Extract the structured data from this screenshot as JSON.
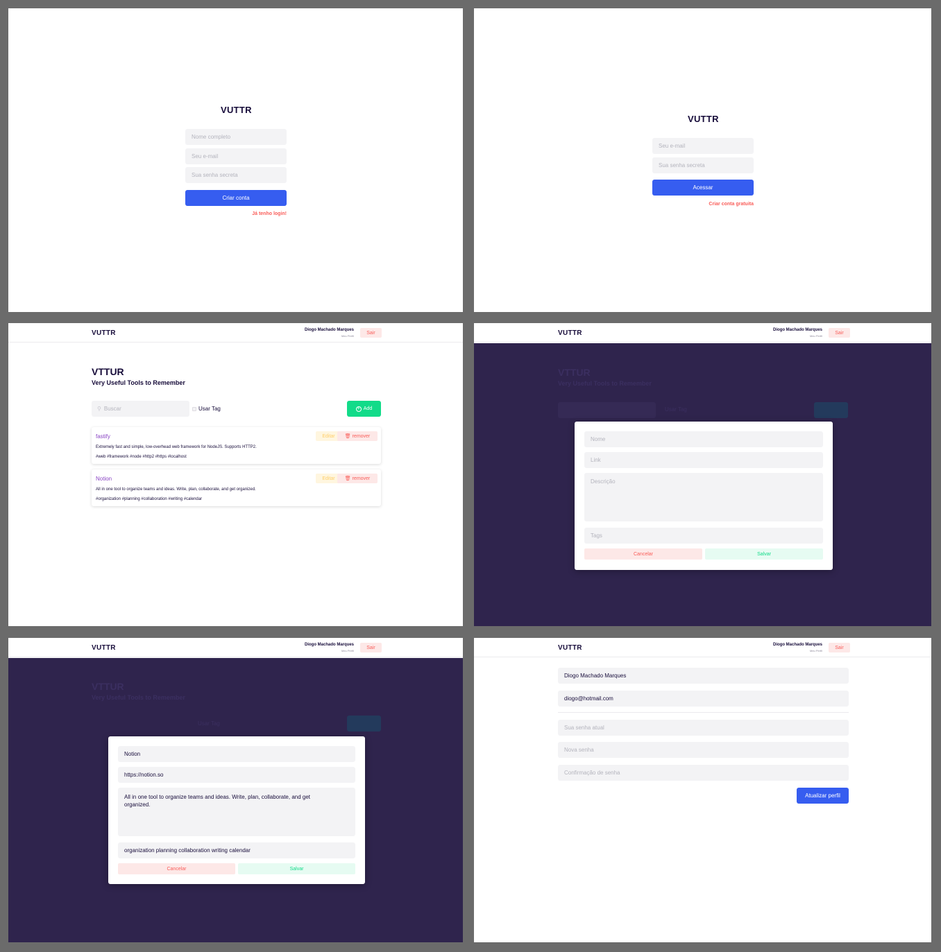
{
  "brand": "VUTTR",
  "signup": {
    "title": "VUTTR",
    "name_placeholder": "Nome completo",
    "email_placeholder": "Seu e-mail",
    "password_placeholder": "Sua senha secreta",
    "submit_label": "Criar conta",
    "login_link": "Já tenho login!"
  },
  "login": {
    "title": "VUTTR",
    "email_placeholder": "Seu e-mail",
    "password_placeholder": "Sua senha secreta",
    "submit_label": "Acessar",
    "signup_link": "Criar conta gratuita"
  },
  "header": {
    "brand": "VUTTR",
    "user_name": "Diogo Machado Marques",
    "profile_link": "Meu Perfil",
    "logout_label": "Sair"
  },
  "dashboard": {
    "title": "VTTUR",
    "subtitle": "Very Useful Tools to Remember",
    "search_placeholder": "Buscar",
    "tag_checkbox_label": "Usar Tag",
    "add_label": "Add",
    "edit_label": "Editar",
    "remove_label": "remover",
    "tools": [
      {
        "title": "fastify",
        "description": "Extremely fast and simple, low-overhead web framework for NodeJS. Supports HTTP2.",
        "tags": "#web  #framework  #node  #http2  #https  #localhost"
      },
      {
        "title": "Notion",
        "description": "All in one tool to organize teams and ideas. Write, plan, collaborate, and get organized.",
        "tags": "#organization  #planning  #collaboration  #writing  #calendar"
      }
    ]
  },
  "add_modal": {
    "name_placeholder": "Nome",
    "link_placeholder": "Link",
    "description_placeholder": "Descrição",
    "tags_placeholder": "Tags",
    "cancel_label": "Cancelar",
    "save_label": "Salvar"
  },
  "edit_modal": {
    "name_value": "Notion",
    "link_value": "https://notion.so",
    "description_value": "All in one tool to organize teams and ideas. Write, plan, collaborate, and get organized.",
    "tags_value": "organization planning collaboration writing calendar",
    "cancel_label": "Cancelar",
    "save_label": "Salvar"
  },
  "profile": {
    "name_value": "Diogo Machado Marques",
    "email_value": "diogo@hotmail.com",
    "current_password_placeholder": "Sua senha atual",
    "new_password_placeholder": "Nova senha",
    "confirm_password_placeholder": "Confirmação de senha",
    "submit_label": "Atualizar perfil"
  },
  "colors": {
    "primary": "#365df0",
    "danger": "#f95e5a",
    "success": "#12db89",
    "warning": "#ffcf6b",
    "overlay": "#2f244d",
    "ink": "#170c3a"
  }
}
